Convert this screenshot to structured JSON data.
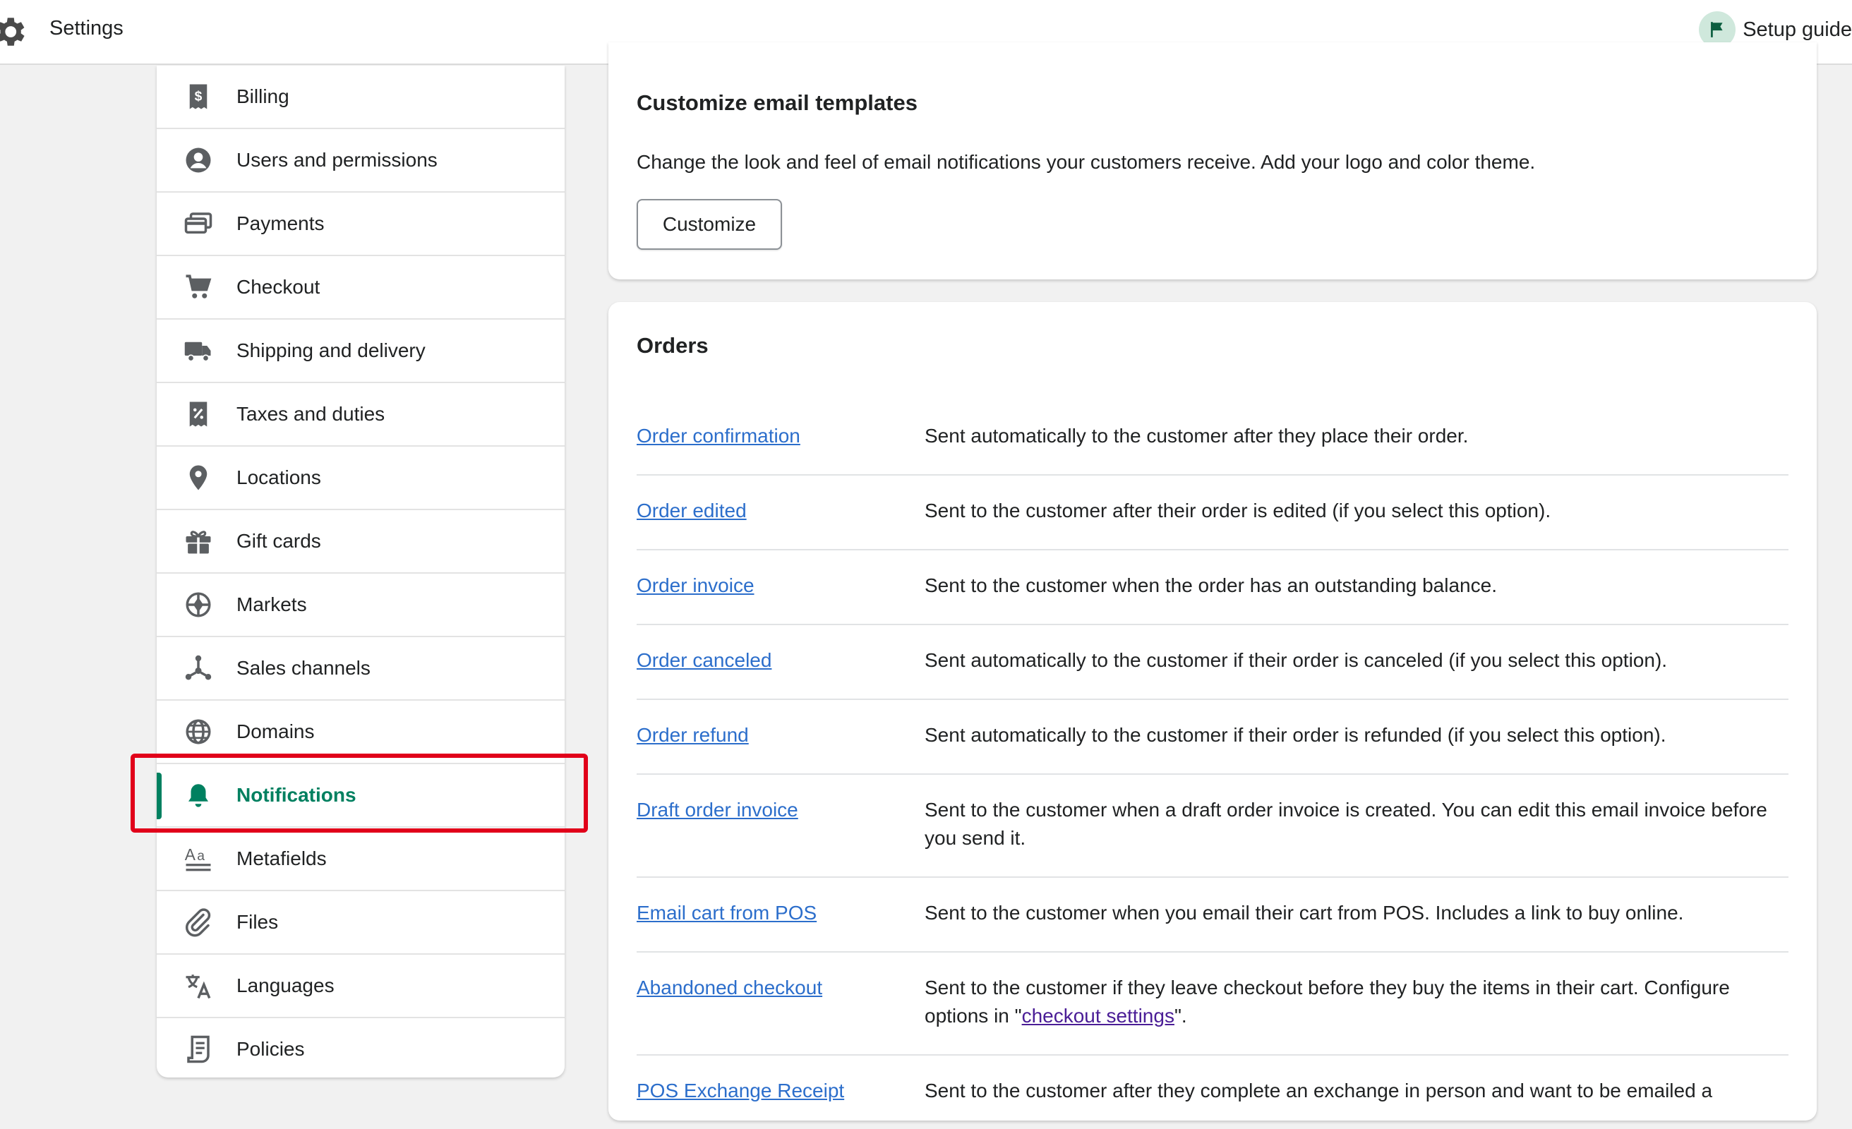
{
  "header": {
    "title": "Settings",
    "setup_guide_label": "Setup guide"
  },
  "sidebar": {
    "items": [
      {
        "label": "Billing",
        "icon": "billing-icon"
      },
      {
        "label": "Users and permissions",
        "icon": "user-icon"
      },
      {
        "label": "Payments",
        "icon": "payments-icon"
      },
      {
        "label": "Checkout",
        "icon": "cart-icon"
      },
      {
        "label": "Shipping and delivery",
        "icon": "truck-icon"
      },
      {
        "label": "Taxes and duties",
        "icon": "tax-icon"
      },
      {
        "label": "Locations",
        "icon": "location-pin-icon"
      },
      {
        "label": "Gift cards",
        "icon": "gift-icon"
      },
      {
        "label": "Markets",
        "icon": "markets-icon"
      },
      {
        "label": "Sales channels",
        "icon": "sales-channels-icon"
      },
      {
        "label": "Domains",
        "icon": "globe-icon"
      },
      {
        "label": "Notifications",
        "icon": "bell-icon",
        "active": true
      },
      {
        "label": "Metafields",
        "icon": "metafields-icon"
      },
      {
        "label": "Files",
        "icon": "paperclip-icon"
      },
      {
        "label": "Languages",
        "icon": "languages-icon"
      },
      {
        "label": "Policies",
        "icon": "policies-icon"
      }
    ]
  },
  "templates_card": {
    "title": "Customize email templates",
    "description": "Change the look and feel of email notifications your customers receive. Add your logo and color theme.",
    "button_label": "Customize"
  },
  "orders_card": {
    "title": "Orders",
    "rows": [
      {
        "link": "Order confirmation",
        "description": "Sent automatically to the customer after they place their order."
      },
      {
        "link": "Order edited",
        "description": "Sent to the customer after their order is edited (if you select this option)."
      },
      {
        "link": "Order invoice",
        "description": "Sent to the customer when the order has an outstanding balance."
      },
      {
        "link": "Order canceled",
        "description": "Sent automatically to the customer if their order is canceled (if you select this option)."
      },
      {
        "link": "Order refund",
        "description": "Sent automatically to the customer if their order is refunded (if you select this option)."
      },
      {
        "link": "Draft order invoice",
        "description": "Sent to the customer when a draft order invoice is created. You can edit this email invoice before you send it."
      },
      {
        "link": "Email cart from POS",
        "description": "Sent to the customer when you email their cart from POS. Includes a link to buy online."
      },
      {
        "link": "Abandoned checkout",
        "description_before": "Sent to the customer if they leave checkout before they buy the items in their cart. Configure options in \"",
        "description_link": "checkout settings",
        "description_after": "\"."
      },
      {
        "link": "POS Exchange Receipt",
        "description": "Sent to the customer after they complete an exchange in person and want to be emailed a"
      }
    ]
  },
  "colors": {
    "accent": "#008060",
    "link": "#2c6ecb",
    "highlight": "#e1001a"
  }
}
